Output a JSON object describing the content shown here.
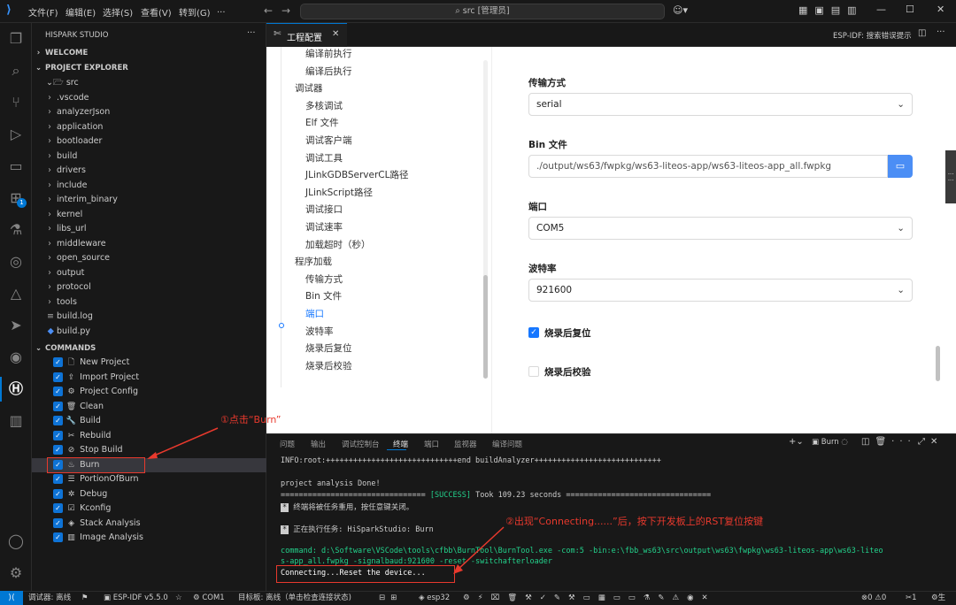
{
  "menu": [
    "文件(F)",
    "编辑(E)",
    "选择(S)",
    "查看(V)",
    "转到(G)",
    "..."
  ],
  "command_center": "src [管理员]",
  "window_controls": [
    "—",
    "☐",
    "✕"
  ],
  "sidebar": {
    "title": "HISPARK STUDIO",
    "more": "···",
    "welcome": "WELCOME",
    "explorer": "PROJECT EXPLORER",
    "root": "src",
    "folders": [
      ".vscode",
      "analyzerJson",
      "application",
      "bootloader",
      "build",
      "drivers",
      "include",
      "interim_binary",
      "kernel",
      "libs_url",
      "middleware",
      "open_source",
      "output",
      "protocol",
      "tools"
    ],
    "files": [
      "build.log",
      "build.py"
    ],
    "commands_header": "COMMANDS",
    "commands": [
      {
        "label": "New Project",
        "icon": "new-file-icon"
      },
      {
        "label": "Import Project",
        "icon": "import-icon"
      },
      {
        "label": "Project Config",
        "icon": "gear-icon"
      },
      {
        "label": "Clean",
        "icon": "trash-icon"
      },
      {
        "label": "Build",
        "icon": "wrench-icon"
      },
      {
        "label": "Rebuild",
        "icon": "tools-icon"
      },
      {
        "label": "Stop Build",
        "icon": "stop-icon"
      },
      {
        "label": "Burn",
        "icon": "flame-icon"
      },
      {
        "label": "PortionOfBurn",
        "icon": "list-icon"
      },
      {
        "label": "Debug",
        "icon": "bug-icon"
      },
      {
        "label": "Kconfig",
        "icon": "kconfig-icon"
      },
      {
        "label": "Stack Analysis",
        "icon": "layers-icon"
      },
      {
        "label": "Image Analysis",
        "icon": "chart-icon"
      }
    ]
  },
  "tabs": {
    "active": "工程配置",
    "right_label": "ESP-IDF: 搜索错误提示"
  },
  "config": {
    "nav": [
      {
        "label": "编译前执行",
        "sub": true
      },
      {
        "label": "编译后执行",
        "sub": true
      },
      {
        "label": "调试器",
        "sub": false
      },
      {
        "label": "多核调试",
        "sub": true
      },
      {
        "label": "Elf 文件",
        "sub": true
      },
      {
        "label": "调试客户端",
        "sub": true
      },
      {
        "label": "调试工具",
        "sub": true
      },
      {
        "label": "JLinkGDBServerCL路径",
        "sub": true
      },
      {
        "label": "JLinkScript路径",
        "sub": true
      },
      {
        "label": "调试接口",
        "sub": true
      },
      {
        "label": "调试速率",
        "sub": true
      },
      {
        "label": "加载超时（秒）",
        "sub": true
      },
      {
        "label": "程序加载",
        "sub": false
      },
      {
        "label": "传输方式",
        "sub": true
      },
      {
        "label": "Bin 文件",
        "sub": true
      },
      {
        "label": "端口",
        "sub": true,
        "active": true
      },
      {
        "label": "波特率",
        "sub": true
      },
      {
        "label": "烧录后复位",
        "sub": true
      },
      {
        "label": "烧录后校验",
        "sub": true
      }
    ],
    "fields": {
      "transfer_label": "传输方式",
      "transfer_value": "serial",
      "bin_label": "Bin 文件",
      "bin_value": "./output/ws63/fwpkg/ws63-liteos-app/ws63-liteos-app_all.fwpkg",
      "port_label": "端口",
      "port_value": "COM5",
      "baud_label": "波特率",
      "baud_value": "921600",
      "reset_label": "烧录后复位",
      "reset_checked": true,
      "verify_label": "烧录后校验",
      "verify_checked": false
    }
  },
  "panel": {
    "tabs": [
      "问题",
      "输出",
      "调试控制台",
      "终端",
      "端口",
      "监视器",
      "编译问题"
    ],
    "active_tab": "终端",
    "terminal_name": "Burn",
    "lines": {
      "l1": "INFO:root:+++++++++++++++++++++++++++++end buildAnalyzer++++++++++++++++++++++++++++",
      "l2": "project analysis Done!",
      "l3a": "================================ ",
      "l3b": "[SUCCESS]",
      "l3c": " Took 109.23 seconds ================================",
      "l4": "终端将被任务重用，按任意键关闭。",
      "l5": "正在执行任务: HiSparkStudio: Burn",
      "l6": "command: d:\\Software\\VSCode\\tools\\cfbb\\BurnTool\\BurnTool.exe -com:5 -bin:e:\\fbb_ws63\\src\\output\\ws63\\fwpkg\\ws63-liteos-app\\ws63-liteo",
      "l7": "s-app_all.fwpkg -signalbaud:921600 -reset -switchafterloader",
      "l8": "Connecting...Reset the device..."
    }
  },
  "annotations": {
    "a1": "①点击“Burn”",
    "a2": "②出现“Connecting......”后，按下开发板上的RST复位按键"
  },
  "statusbar": {
    "debugger": "调试器: 离线",
    "espidf": "ESP-IDF v5.5.0",
    "port": "COM1",
    "board": "目标板: 离线（单击检查连接状态)",
    "target": "esp32",
    "problems": "⊗0 ⚠0",
    "ports": "1",
    "tail": "生"
  },
  "colors": {
    "accent": "#1677ff",
    "annotation": "#e8392d",
    "checkbox": "#0e73d6",
    "success": "#23d18b"
  }
}
